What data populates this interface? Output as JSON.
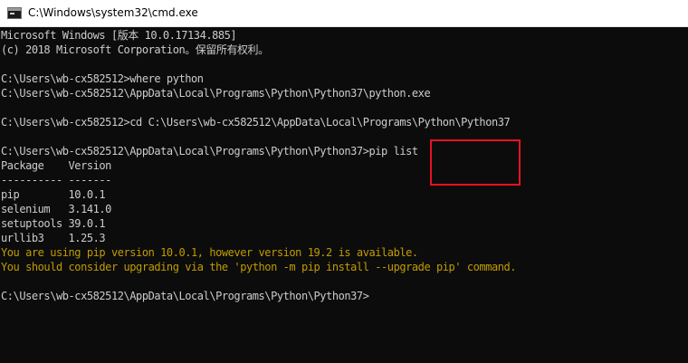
{
  "window": {
    "title": "C:\\Windows\\system32\\cmd.exe",
    "icon": "cmd-icon"
  },
  "console": {
    "lines": [
      "Microsoft Windows [版本 10.0.17134.885]",
      "(c) 2018 Microsoft Corporation。保留所有权利。",
      "",
      "C:\\Users\\wb-cx582512>where python",
      "C:\\Users\\wb-cx582512\\AppData\\Local\\Programs\\Python\\Python37\\python.exe",
      "",
      "C:\\Users\\wb-cx582512>cd C:\\Users\\wb-cx582512\\AppData\\Local\\Programs\\Python\\Python37",
      "",
      "C:\\Users\\wb-cx582512\\AppData\\Local\\Programs\\Python\\Python37>pip list",
      "Package    Version",
      "---------- -------",
      "pip        10.0.1",
      "selenium   3.141.0",
      "setuptools 39.0.1",
      "urllib3    1.25.3",
      "You are using pip version 10.0.1, however version 19.2 is available.",
      "You should consider upgrading via the 'python -m pip install --upgrade pip' command.",
      "",
      "C:\\Users\\wb-cx582512\\AppData\\Local\\Programs\\Python\\Python37>"
    ]
  },
  "colors": {
    "console_background": "#0c0c0c",
    "console_text": "#cccccc",
    "warning_text": "#c19c00",
    "highlight_box": "#e81123"
  }
}
